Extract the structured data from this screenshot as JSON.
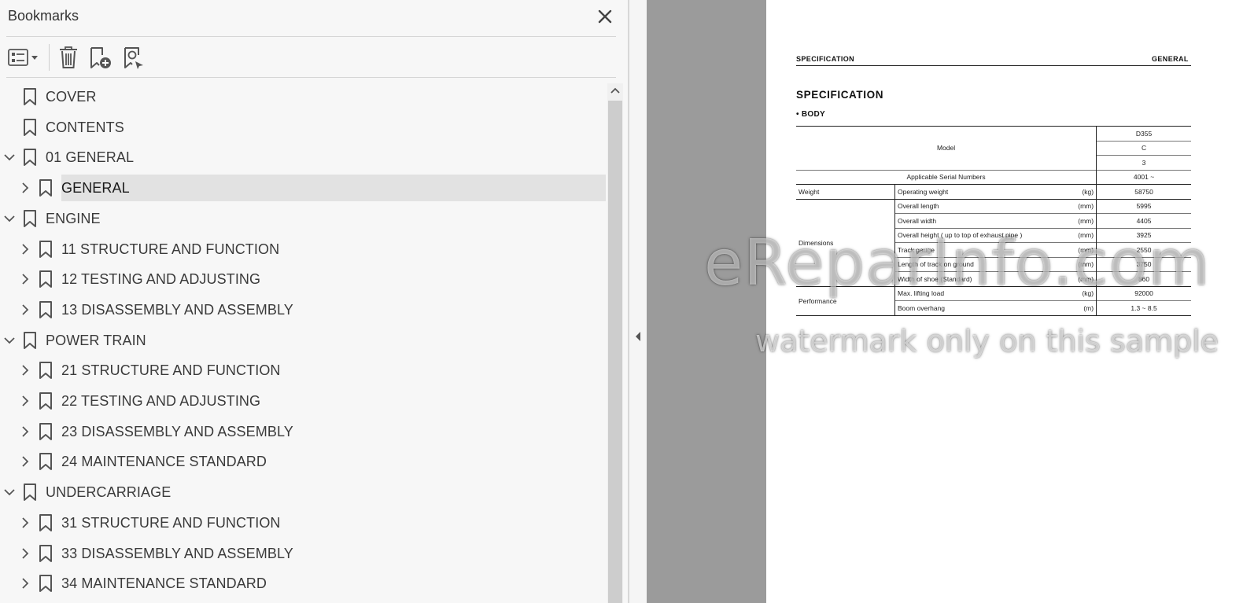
{
  "panel": {
    "title": "Bookmarks",
    "toolbar": {
      "options_icon": "list-options-icon",
      "delete_icon": "trash-icon",
      "new_bookmark_icon": "bookmark-add-icon",
      "find_bookmark_icon": "bookmark-search-icon"
    }
  },
  "bookmarks": [
    {
      "label": "COVER",
      "level": 0,
      "chevron": "none"
    },
    {
      "label": "CONTENTS",
      "level": 0,
      "chevron": "none"
    },
    {
      "label": "01 GENERAL",
      "level": 0,
      "chevron": "down"
    },
    {
      "label": "GENERAL",
      "level": 1,
      "chevron": "right",
      "selected": true
    },
    {
      "label": "ENGINE",
      "level": 0,
      "chevron": "down"
    },
    {
      "label": "11 STRUCTURE AND FUNCTION",
      "level": 1,
      "chevron": "right"
    },
    {
      "label": "12 TESTING AND ADJUSTING",
      "level": 1,
      "chevron": "right"
    },
    {
      "label": "13 DISASSEMBLY AND ASSEMBLY",
      "level": 1,
      "chevron": "right"
    },
    {
      "label": "POWER TRAIN",
      "level": 0,
      "chevron": "down"
    },
    {
      "label": "21 STRUCTURE AND FUNCTION",
      "level": 1,
      "chevron": "right"
    },
    {
      "label": "22 TESTING AND ADJUSTING",
      "level": 1,
      "chevron": "right"
    },
    {
      "label": "23 DISASSEMBLY AND ASSEMBLY",
      "level": 1,
      "chevron": "right"
    },
    {
      "label": "24 MAINTENANCE STANDARD",
      "level": 1,
      "chevron": "right"
    },
    {
      "label": "UNDERCARRIAGE",
      "level": 0,
      "chevron": "down"
    },
    {
      "label": "31 STRUCTURE AND FUNCTION",
      "level": 1,
      "chevron": "right"
    },
    {
      "label": "33 DISASSEMBLY AND ASSEMBLY",
      "level": 1,
      "chevron": "right"
    },
    {
      "label": "34 MAINTENANCE STANDARD",
      "level": 1,
      "chevron": "right"
    }
  ],
  "document": {
    "header_left": "SPECIFICATION",
    "header_right": "GENERAL",
    "title": "SPECIFICATION",
    "section": "• BODY",
    "model_label": "Model",
    "model_values": [
      "D355",
      "C",
      "3"
    ],
    "serial_label": "Applicable Serial Numbers",
    "serial_value": "4001 ~",
    "groups": [
      {
        "name": "Weight",
        "rows": [
          {
            "item": "Operating weight",
            "unit": "(kg)",
            "value": "58750"
          }
        ]
      },
      {
        "name": "Dimensions",
        "rows": [
          {
            "item": "Overall length",
            "unit": "(mm)",
            "value": "5995"
          },
          {
            "item": "Overall width",
            "unit": "(mm)",
            "value": "4405"
          },
          {
            "item": "Overall height  ( up to top of exhaust pipe )",
            "unit": "(mm)",
            "value": "3925"
          },
          {
            "item": "Track gauge",
            "unit": "(mm)",
            "value": "2550"
          },
          {
            "item": "Length of track on ground",
            "unit": "(mm)",
            "value": "3750"
          },
          {
            "item": "Width of shoe (Standard)",
            "unit": "(mm)",
            "value": "860"
          }
        ]
      },
      {
        "name": "Performance",
        "rows": [
          {
            "item": "Max. lifting load",
            "unit": "(kg)",
            "value": "92000"
          },
          {
            "item": "Boom overhang",
            "unit": "(m)",
            "value": "1.3 ~ 8.5"
          }
        ]
      }
    ]
  },
  "watermark": {
    "line1": "eReparInfo.com",
    "line2": "watermark only on this sample"
  }
}
